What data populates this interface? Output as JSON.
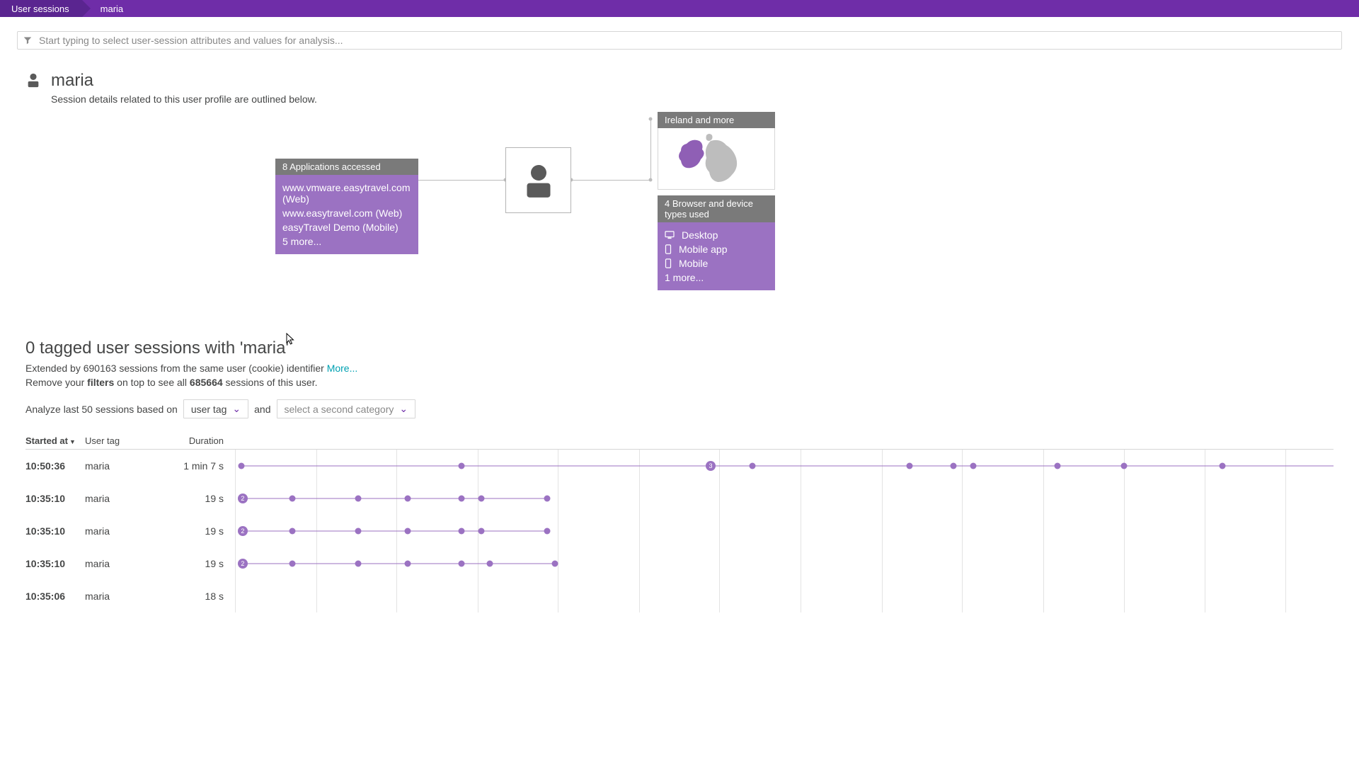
{
  "breadcrumb": {
    "root": "User sessions",
    "current": "maria"
  },
  "filter": {
    "placeholder": "Start typing to select user-session attributes and values for analysis..."
  },
  "profile": {
    "name": "maria",
    "subtitle": "Session details related to this user profile are outlined below."
  },
  "apps_card": {
    "title": "8 Applications accessed",
    "items": [
      "www.vmware.easytravel.com (Web)",
      "www.easytravel.com (Web)",
      "easyTravel Demo (Mobile)"
    ],
    "more": "5 more..."
  },
  "geo_card": {
    "title": "Ireland and more"
  },
  "devices_card": {
    "title": "4 Browser and device types used",
    "items": [
      "Desktop",
      "Mobile app",
      "Mobile"
    ],
    "more": "1 more..."
  },
  "sessions": {
    "heading": "0 tagged user sessions with 'maria'",
    "extended_prefix": "Extended by ",
    "extended_count": "690163",
    "extended_suffix": " sessions from the same user (cookie) identifier ",
    "more_link": "More...",
    "remove_prefix": "Remove your ",
    "remove_bold": "filters",
    "remove_mid": " on top to see all ",
    "remove_count": "685664",
    "remove_suffix": " sessions of this user."
  },
  "analyze": {
    "prefix": "Analyze last 50 sessions based on",
    "select1": "user tag",
    "and": "and",
    "select2": "select a second category"
  },
  "columns": {
    "started": "Started at",
    "user_tag": "User tag",
    "duration": "Duration"
  },
  "gridlines": [
    0,
    7.4,
    14.7,
    22.1,
    29.4,
    36.8,
    44.1,
    51.5,
    58.9,
    66.2,
    73.6,
    80.9,
    88.3,
    95.6
  ],
  "rows": [
    {
      "start": "10:50:36",
      "tag": "maria",
      "dur": "1 min 7 s",
      "line": {
        "from": 0.6,
        "to": 100
      },
      "dots": [
        {
          "x": 0.6
        },
        {
          "x": 20.6
        },
        {
          "x": 43.3,
          "label": "3"
        },
        {
          "x": 47.1
        },
        {
          "x": 61.4
        },
        {
          "x": 65.4
        },
        {
          "x": 67.2
        },
        {
          "x": 74.9
        },
        {
          "x": 80.9
        },
        {
          "x": 89.9
        }
      ]
    },
    {
      "start": "10:35:10",
      "tag": "maria",
      "dur": "19 s",
      "line": {
        "from": 0.7,
        "to": 28.4
      },
      "dots": [
        {
          "x": 0.7,
          "label": "2"
        },
        {
          "x": 5.2
        },
        {
          "x": 11.2
        },
        {
          "x": 15.7
        },
        {
          "x": 20.6
        },
        {
          "x": 22.4
        },
        {
          "x": 28.4
        }
      ]
    },
    {
      "start": "10:35:10",
      "tag": "maria",
      "dur": "19 s",
      "line": {
        "from": 0.7,
        "to": 28.4
      },
      "dots": [
        {
          "x": 0.7,
          "label": "2"
        },
        {
          "x": 5.2
        },
        {
          "x": 11.2
        },
        {
          "x": 15.7
        },
        {
          "x": 20.6
        },
        {
          "x": 22.4
        },
        {
          "x": 28.4
        }
      ]
    },
    {
      "start": "10:35:10",
      "tag": "maria",
      "dur": "19 s",
      "line": {
        "from": 0.7,
        "to": 29.1
      },
      "dots": [
        {
          "x": 0.7,
          "label": "2"
        },
        {
          "x": 5.2
        },
        {
          "x": 11.2
        },
        {
          "x": 15.7
        },
        {
          "x": 20.6
        },
        {
          "x": 23.2
        },
        {
          "x": 29.1
        }
      ]
    },
    {
      "start": "10:35:06",
      "tag": "maria",
      "dur": "18 s",
      "line": {
        "from": 0.7,
        "to": 0.7
      },
      "dots": []
    }
  ]
}
